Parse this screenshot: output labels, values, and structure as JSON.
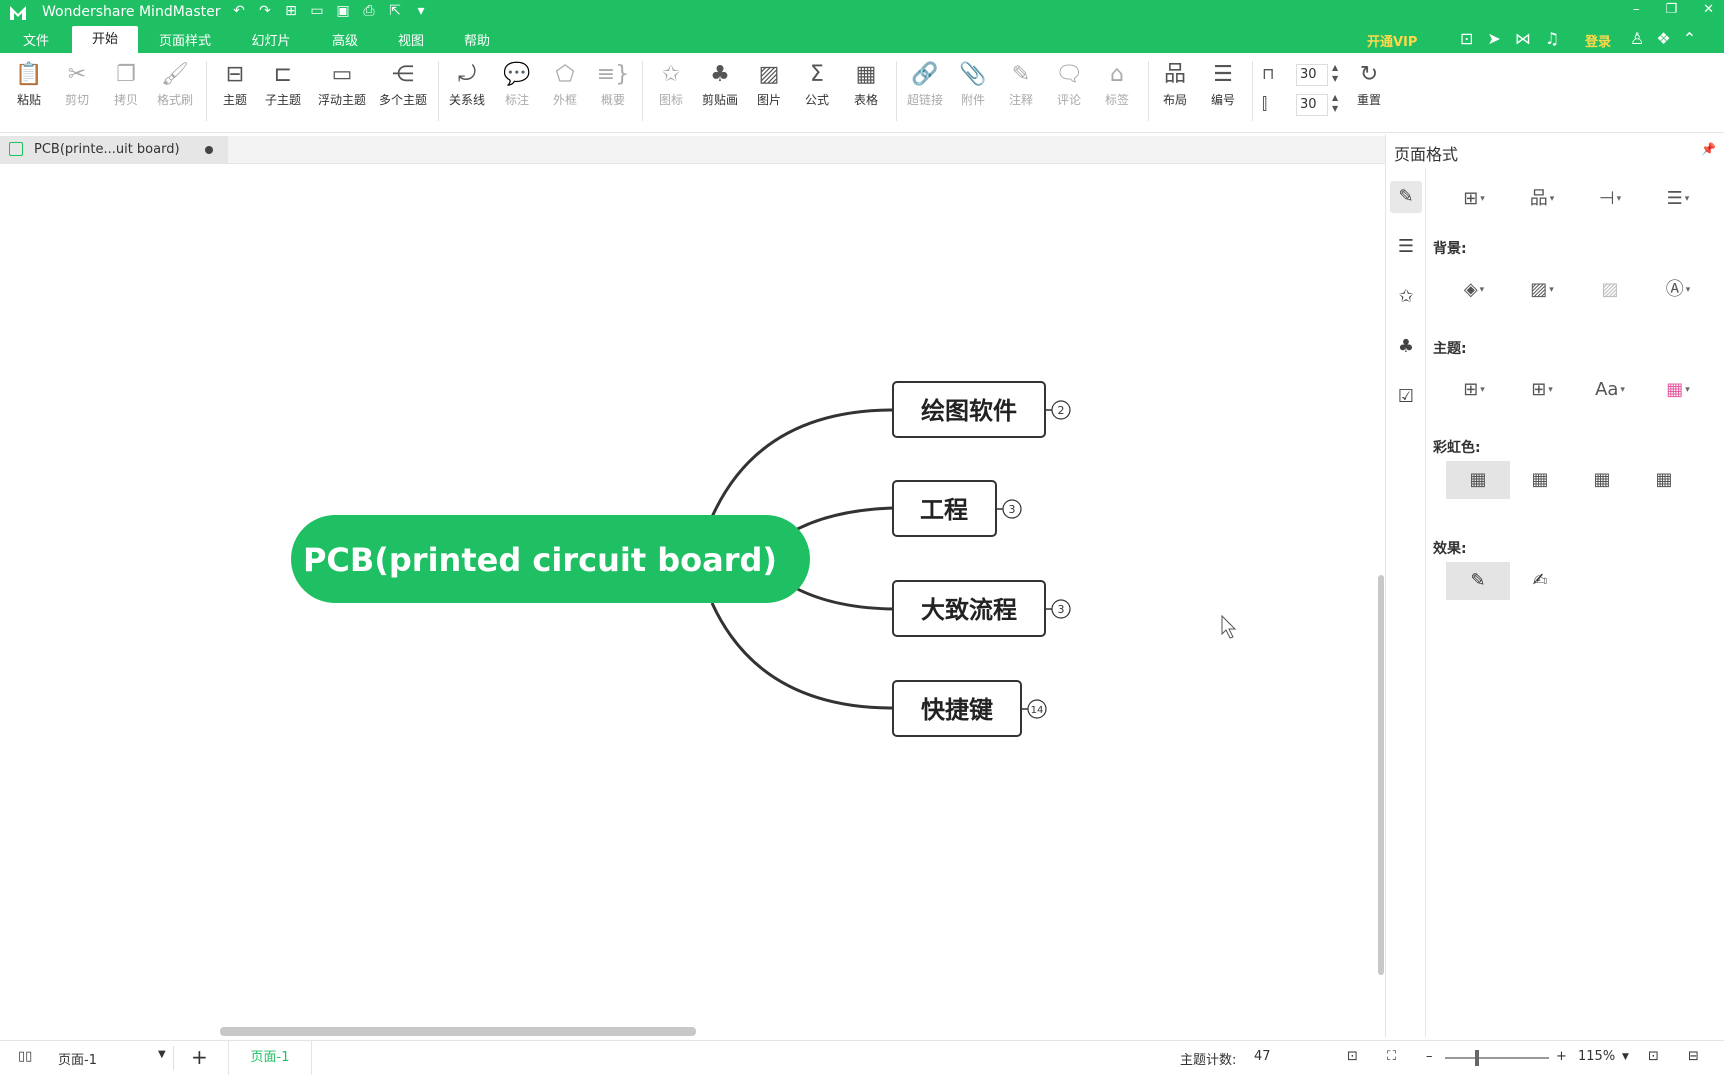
{
  "titlebar": {
    "app_title": "Wondershare MindMaster",
    "quick_access": [
      "undo-icon",
      "redo-icon",
      "new-icon",
      "open-icon",
      "save-icon",
      "print-icon",
      "export-icon",
      "more-icon"
    ]
  },
  "menu": {
    "tabs": [
      "文件",
      "开始",
      "页面样式",
      "幻灯片",
      "高级",
      "视图",
      "帮助"
    ],
    "active_tab": "开始",
    "vip_label": "开通VIP",
    "login_label": "登录"
  },
  "ribbon": {
    "buttons": [
      {
        "id": "paste",
        "label": "粘贴",
        "icon": "clipboard-icon"
      },
      {
        "id": "cut",
        "label": "剪切",
        "icon": "scissors-icon"
      },
      {
        "id": "copy",
        "label": "拷贝",
        "icon": "copy-icon"
      },
      {
        "id": "format-painter",
        "label": "格式刷",
        "icon": "brush-icon"
      },
      {
        "id": "topic",
        "label": "主题",
        "icon": "topic-icon"
      },
      {
        "id": "subtopic",
        "label": "子主题",
        "icon": "subtopic-icon"
      },
      {
        "id": "floating-topic",
        "label": "浮动主题",
        "icon": "floating-topic-icon"
      },
      {
        "id": "multiple-topics",
        "label": "多个主题",
        "icon": "multiple-topics-icon"
      },
      {
        "id": "relationship",
        "label": "关系线",
        "icon": "relationship-icon"
      },
      {
        "id": "callout",
        "label": "标注",
        "icon": "callout-icon"
      },
      {
        "id": "boundary",
        "label": "外框",
        "icon": "boundary-icon"
      },
      {
        "id": "summary",
        "label": "概要",
        "icon": "summary-icon"
      },
      {
        "id": "icon",
        "label": "图标",
        "icon": "star-badge-icon"
      },
      {
        "id": "clipart",
        "label": "剪贴画",
        "icon": "clover-icon"
      },
      {
        "id": "picture",
        "label": "图片",
        "icon": "image-icon"
      },
      {
        "id": "formula",
        "label": "公式",
        "icon": "sigma-icon"
      },
      {
        "id": "table",
        "label": "表格",
        "icon": "table-icon"
      },
      {
        "id": "hyperlink",
        "label": "超链接",
        "icon": "link-icon"
      },
      {
        "id": "attachment",
        "label": "附件",
        "icon": "paperclip-icon"
      },
      {
        "id": "note",
        "label": "注释",
        "icon": "pencil-icon"
      },
      {
        "id": "comment",
        "label": "评论",
        "icon": "comment-icon"
      },
      {
        "id": "tag",
        "label": "标签",
        "icon": "tag-icon"
      },
      {
        "id": "layout",
        "label": "布局",
        "icon": "layout-icon"
      },
      {
        "id": "numbering",
        "label": "编号",
        "icon": "numbering-icon"
      },
      {
        "id": "reset",
        "label": "重置",
        "icon": "reset-icon"
      }
    ],
    "spacing_h": "30",
    "spacing_v": "30"
  },
  "document": {
    "tab_name": "PCB(printe...uit board)",
    "unsaved": true
  },
  "mindmap": {
    "central": "PCB(printed circuit board)",
    "branches": [
      {
        "label": "绘图软件",
        "count": "2"
      },
      {
        "label": "工程",
        "count": "3"
      },
      {
        "label": "大致流程",
        "count": "3"
      },
      {
        "label": "快捷键",
        "count": "14"
      }
    ],
    "colors": {
      "central": "#1fbf63",
      "line": "#333333"
    }
  },
  "panel": {
    "title": "页面格式",
    "sections": {
      "background": "背景:",
      "theme": "主题:",
      "rainbow": "彩虹色:",
      "effect": "效果:"
    },
    "side_icons": [
      "format-icon",
      "outline-icon",
      "icon-library-icon",
      "clipart-icon",
      "task-icon"
    ]
  },
  "statusbar": {
    "page_select": "页面-1",
    "page_tab": "页面-1",
    "topic_count_label": "主题计数:",
    "topic_count": "47",
    "zoom": "115%"
  },
  "colors": {
    "brand": "#1fbf63",
    "vip": "#ffd94a"
  }
}
